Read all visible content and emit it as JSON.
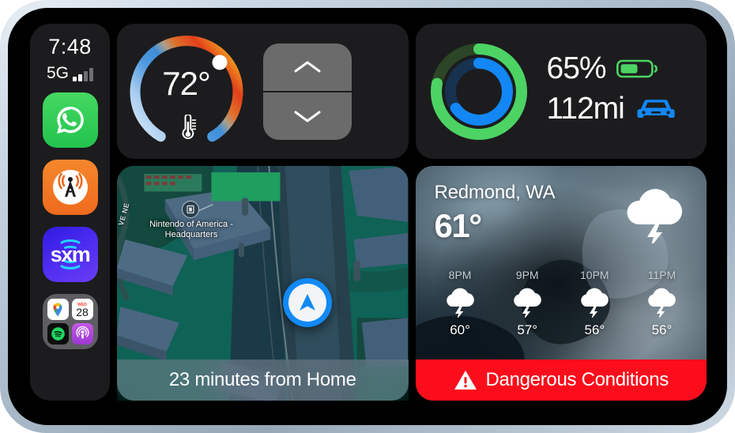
{
  "status": {
    "time": "7:48",
    "network_label": "5G",
    "signal_bars_total": 4,
    "signal_bars_active": 2
  },
  "sidebar": {
    "apps": [
      {
        "id": "whatsapp",
        "label": "WhatsApp",
        "icon": "whatsapp-icon",
        "color": "#25D366"
      },
      {
        "id": "iheartradio",
        "label": "iHeartRadio",
        "icon": "radio-tower-icon",
        "color": "#F06A1E"
      },
      {
        "id": "siriusxm",
        "label": "sxm",
        "icon": "sxm-icon",
        "color": "#4B2BF0"
      },
      {
        "id": "folder",
        "label": "Folder",
        "icon": "folder-icon",
        "color": "#96969B"
      }
    ],
    "folder_apps": [
      {
        "id": "google-maps",
        "label": "Google Maps",
        "icon": "google-maps-icon"
      },
      {
        "id": "calendar",
        "label": "Calendar",
        "icon": "calendar-icon",
        "weekday": "WED",
        "day": "28"
      },
      {
        "id": "spotify",
        "label": "Spotify",
        "icon": "spotify-icon"
      },
      {
        "id": "podcasts",
        "label": "Podcasts",
        "icon": "podcasts-icon"
      }
    ]
  },
  "climate": {
    "temperature": "72°",
    "gauge_min": 60,
    "gauge_max": 85,
    "gauge_value": 72,
    "thermometer_icon": "thermometer-icon",
    "increase_label": "chevron-up-icon",
    "decrease_label": "chevron-down-icon",
    "cold_color": "#cfe3f7",
    "hot_color": "#f08a1e"
  },
  "ev": {
    "battery_percent": "65%",
    "range": "112mi",
    "battery_icon": "battery-icon",
    "car_icon": "car-icon",
    "outer_ring_percent": 78,
    "inner_ring_percent": 65,
    "outer_ring_color": "#4cd364",
    "inner_ring_color": "#1287f5"
  },
  "map": {
    "poi_label": "Nintendo of America - Headquarters",
    "street_label": "VE NE",
    "eta": "23 minutes from Home",
    "poi_icon": "building-marker-icon",
    "navigation_icon": "navigation-arrow-icon"
  },
  "weather": {
    "location": "Redmond, WA",
    "temperature": "61°",
    "condition_icon": "thunderstorm-icon",
    "hourly": [
      {
        "time": "8PM",
        "icon": "thunderstorm-icon",
        "temp": "60°"
      },
      {
        "time": "9PM",
        "icon": "thunderstorm-icon",
        "temp": "57°"
      },
      {
        "time": "10PM",
        "icon": "thunderstorm-icon",
        "temp": "56°"
      },
      {
        "time": "11PM",
        "icon": "thunderstorm-icon",
        "temp": "56°"
      }
    ],
    "alert_text": "Dangerous Conditions",
    "alert_icon": "warning-triangle-icon",
    "alert_color": "#FC0D1B"
  }
}
